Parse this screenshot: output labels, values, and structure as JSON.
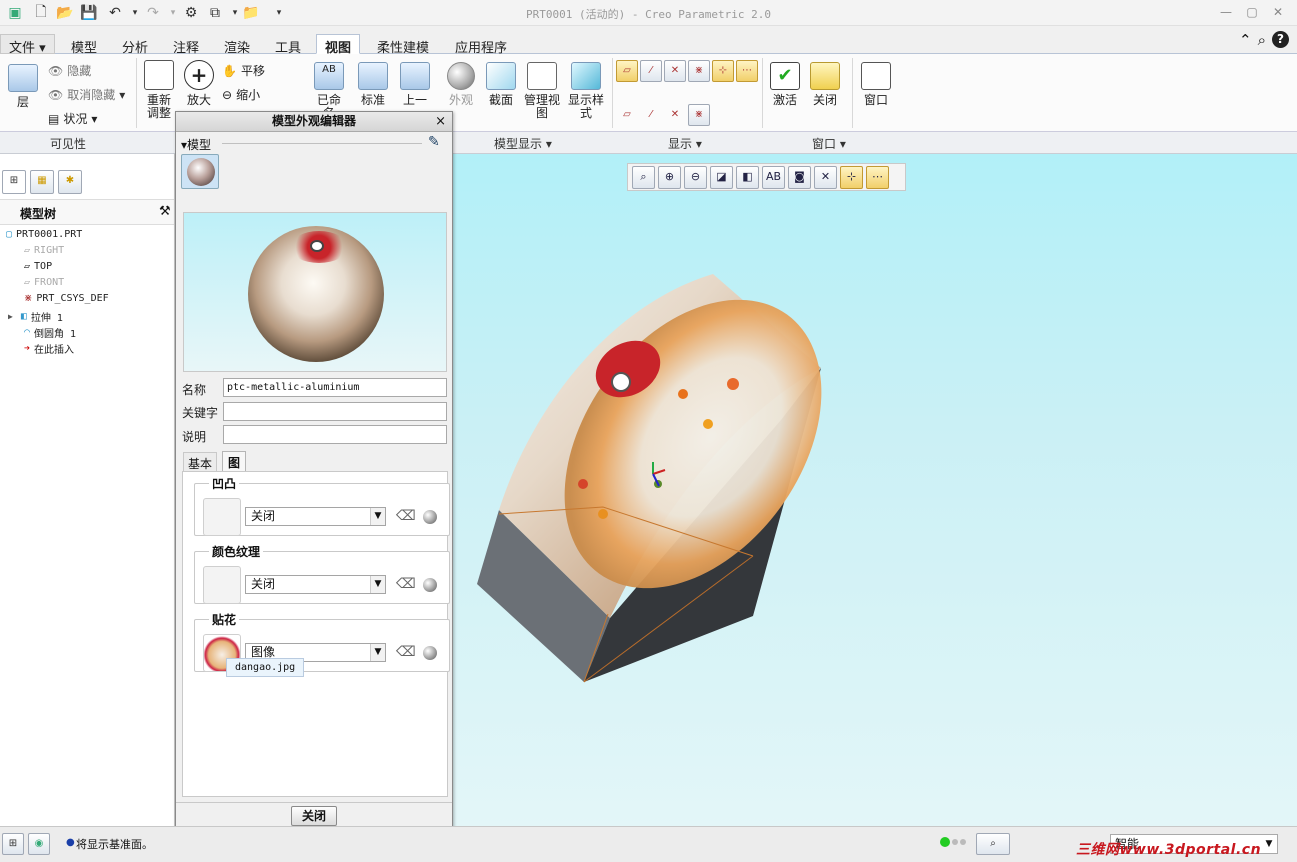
{
  "window": {
    "title": "PRT0001 (活动的) - Creo Parametric 2.0"
  },
  "tabs": [
    "文件",
    "模型",
    "分析",
    "注释",
    "渲染",
    "工具",
    "视图",
    "柔性建模",
    "应用程序"
  ],
  "active_tab": "视图",
  "ribbon": {
    "layer": "层",
    "hide": "隐藏",
    "unhide": "取消隐藏",
    "status": "状况",
    "refit": "重新调整",
    "zoom_in": "放大",
    "pan": "平移",
    "zoom_out": "缩小",
    "named_view": "已命名",
    "standard": "标准",
    "previous": "上一",
    "appearance": "外观",
    "section": "截面",
    "manage_views": "管理视图",
    "display_style": "显示样式",
    "activate": "激活",
    "close": "关闭",
    "window": "窗口"
  },
  "groups": {
    "visibility": "可见性",
    "model_display": "模型显示",
    "display": "显示",
    "window": "窗口"
  },
  "model_tree": {
    "heading": "模型树",
    "items": [
      {
        "label": "PRT0001.PRT",
        "icon": "part-icon",
        "muted": false
      },
      {
        "label": "RIGHT",
        "icon": "datum-plane-icon",
        "muted": true
      },
      {
        "label": "TOP",
        "icon": "datum-plane-icon",
        "muted": false
      },
      {
        "label": "FRONT",
        "icon": "datum-plane-icon",
        "muted": true
      },
      {
        "label": "PRT_CSYS_DEF",
        "icon": "csys-icon",
        "muted": false
      },
      {
        "label": "拉伸 1",
        "icon": "extrude-icon",
        "muted": false
      },
      {
        "label": "倒圆角 1",
        "icon": "round-icon",
        "muted": false
      },
      {
        "label": "在此插入",
        "icon": "insert-arrow-icon",
        "muted": false
      }
    ]
  },
  "dialog": {
    "title": "模型外观编辑器",
    "model_label": "模型",
    "name_label": "名称",
    "name_value": "ptc-metallic-aluminium",
    "keyword_label": "关键字",
    "keyword_value": "",
    "desc_label": "说明",
    "desc_value": "",
    "tab_basic": "基本",
    "tab_map": "图",
    "bump_label": "凹凸",
    "bump_value": "关闭",
    "color_texture_label": "颜色纹理",
    "color_texture_value": "关闭",
    "decal_label": "贴花",
    "decal_value": "图像",
    "decal_tooltip": "dangao.jpg",
    "close_button": "关闭"
  },
  "statusbar": {
    "message": "将显示基准面。",
    "filter_value": "智能"
  },
  "watermark": "三维网www.3dportal.cn"
}
